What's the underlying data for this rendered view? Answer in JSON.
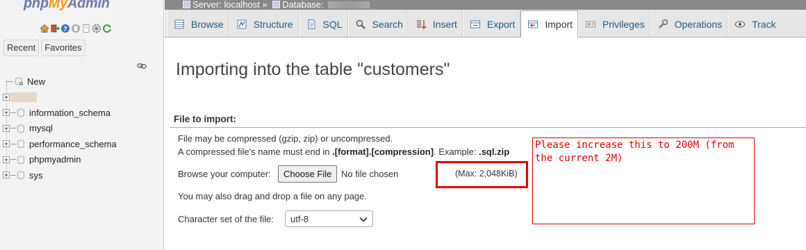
{
  "app": {
    "logo": {
      "php": "php",
      "my": "My",
      "admin": "Admin"
    }
  },
  "nav": {
    "icons": [
      "home-icon",
      "logout-icon",
      "help-icon",
      "docs-icon",
      "copy-icon",
      "settings-icon",
      "reload-icon"
    ],
    "recent_label": "Recent",
    "favorites_label": "Favorites",
    "tree": [
      {
        "label": "New",
        "type": "new"
      },
      {
        "label": "",
        "type": "blurred"
      },
      {
        "label": "information_schema",
        "type": "db"
      },
      {
        "label": "mysql",
        "type": "db"
      },
      {
        "label": "performance_schema",
        "type": "db"
      },
      {
        "label": "phpmyadmin",
        "type": "db"
      },
      {
        "label": "sys",
        "type": "db"
      }
    ]
  },
  "breadcrumb": {
    "server": "Server: localhost »",
    "database": "Database:"
  },
  "tabs": [
    {
      "label": "Browse",
      "icon": "browse-icon"
    },
    {
      "label": "Structure",
      "icon": "structure-icon"
    },
    {
      "label": "SQL",
      "icon": "sql-icon"
    },
    {
      "label": "Search",
      "icon": "search-icon"
    },
    {
      "label": "Insert",
      "icon": "insert-icon"
    },
    {
      "label": "Export",
      "icon": "export-icon"
    },
    {
      "label": "Import",
      "icon": "import-icon",
      "active": true
    },
    {
      "label": "Privileges",
      "icon": "privileges-icon"
    },
    {
      "label": "Operations",
      "icon": "operations-icon"
    },
    {
      "label": "Track",
      "icon": "tracking-icon"
    }
  ],
  "main": {
    "title": "Importing into the table \"customers\"",
    "section_title": "File to import:",
    "compress_line": "File may be compressed (gzip, zip) or uncompressed.",
    "name_line_prefix": "A compressed file's name must end in ",
    "name_line_format": ".[format].[compression]",
    "name_line_mid": ". Example: ",
    "name_line_example": ".sql.zip",
    "browse_label": "Browse your computer:",
    "choose_file_label": "Choose File",
    "no_file_text": "No file chosen",
    "max_size": "(Max: 2,048KiB)",
    "drag_text": "You may also drag and drop a file on any page.",
    "charset_label": "Character set of the file:",
    "charset_value": "utf-8"
  },
  "annotation": {
    "note": "Please increase this to 200M (from the current 2M)",
    "color": "#e00000"
  }
}
